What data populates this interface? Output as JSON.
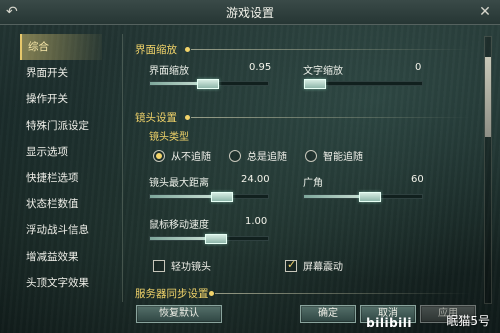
{
  "window": {
    "title": "游戏设置"
  },
  "icons": {
    "back": "back-arrow-icon",
    "close": "close-icon"
  },
  "sidebar": {
    "items": [
      {
        "label": "综合",
        "active": true
      },
      {
        "label": "界面开关"
      },
      {
        "label": "操作开关"
      },
      {
        "label": "特殊门派设定"
      },
      {
        "label": "显示选项"
      },
      {
        "label": "快捷栏选项"
      },
      {
        "label": "状态栏数值"
      },
      {
        "label": "浮动战斗信息"
      },
      {
        "label": "增减益效果"
      },
      {
        "label": "头顶文字效果"
      }
    ]
  },
  "panel": {
    "ui_scale_section": {
      "title": "界面缩放",
      "ui_scale": {
        "label": "界面缩放",
        "value": "0.95",
        "fraction": 0.48
      },
      "text_scale": {
        "label": "文字缩放",
        "value": "0",
        "fraction": 0.0
      }
    },
    "camera_section": {
      "title": "镜头设置",
      "camera_type": {
        "label": "镜头类型",
        "options": [
          {
            "label": "从不追随",
            "selected": true
          },
          {
            "label": "总是追随",
            "selected": false
          },
          {
            "label": "智能追随",
            "selected": false
          }
        ]
      },
      "max_distance": {
        "label": "镜头最大距离",
        "value": "24.00",
        "fraction": 0.6
      },
      "fov": {
        "label": "广角",
        "value": "60",
        "fraction": 0.55
      },
      "mouse_speed": {
        "label": "鼠标移动速度",
        "value": "1.00",
        "fraction": 0.55
      },
      "checks": [
        {
          "label": "轻功镜头",
          "checked": false
        },
        {
          "label": "屏幕震动",
          "checked": true
        }
      ]
    },
    "server_sync_section": {
      "title": "服务器同步设置"
    }
  },
  "buttons": {
    "reset": "恢复默认",
    "ok": "确定",
    "cancel": "取消",
    "apply": "应用"
  },
  "watermark": {
    "logo": "bilibili",
    "text": "眠猫5号"
  }
}
